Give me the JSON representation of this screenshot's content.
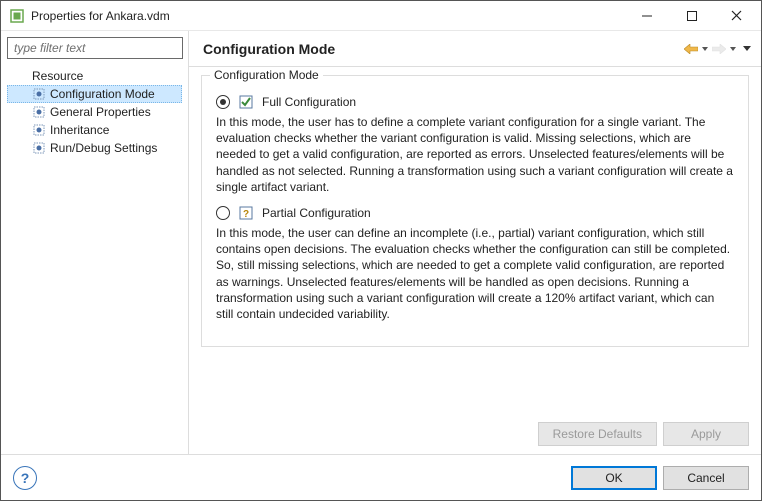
{
  "window": {
    "title": "Properties for Ankara.vdm"
  },
  "sidebar": {
    "filter_placeholder": "type filter text",
    "items": [
      {
        "label": "Resource"
      },
      {
        "label": "Configuration Mode",
        "selected": true
      },
      {
        "label": "General Properties"
      },
      {
        "label": "Inheritance"
      },
      {
        "label": "Run/Debug Settings"
      }
    ]
  },
  "main": {
    "heading": "Configuration Mode",
    "group_title": "Configuration Mode",
    "options": [
      {
        "label": "Full Configuration",
        "checked": true,
        "desc": "In this mode, the user has to define a complete variant configuration for a single variant. The evaluation checks whether the variant configuration is valid. Missing selections, which are needed to get a valid configuration, are reported as errors. Unselected features/elements will be handled as not selected. Running a transformation using such a variant configuration will create a single artifact variant."
      },
      {
        "label": "Partial Configuration",
        "checked": false,
        "desc": "In this mode, the user can define an incomplete (i.e., partial) variant configuration, which still contains open decisions. The evaluation checks whether the configuration can still be completed. So, still missing selections, which are needed to get a complete valid configuration, are reported as warnings. Unselected features/elements will be handled as open decisions. Running a transformation using such a variant configuration will create a 120% artifact variant, which can still contain undecided variability."
      }
    ],
    "buttons": {
      "restore": "Restore Defaults",
      "apply": "Apply"
    }
  },
  "footer": {
    "ok": "OK",
    "cancel": "Cancel"
  }
}
